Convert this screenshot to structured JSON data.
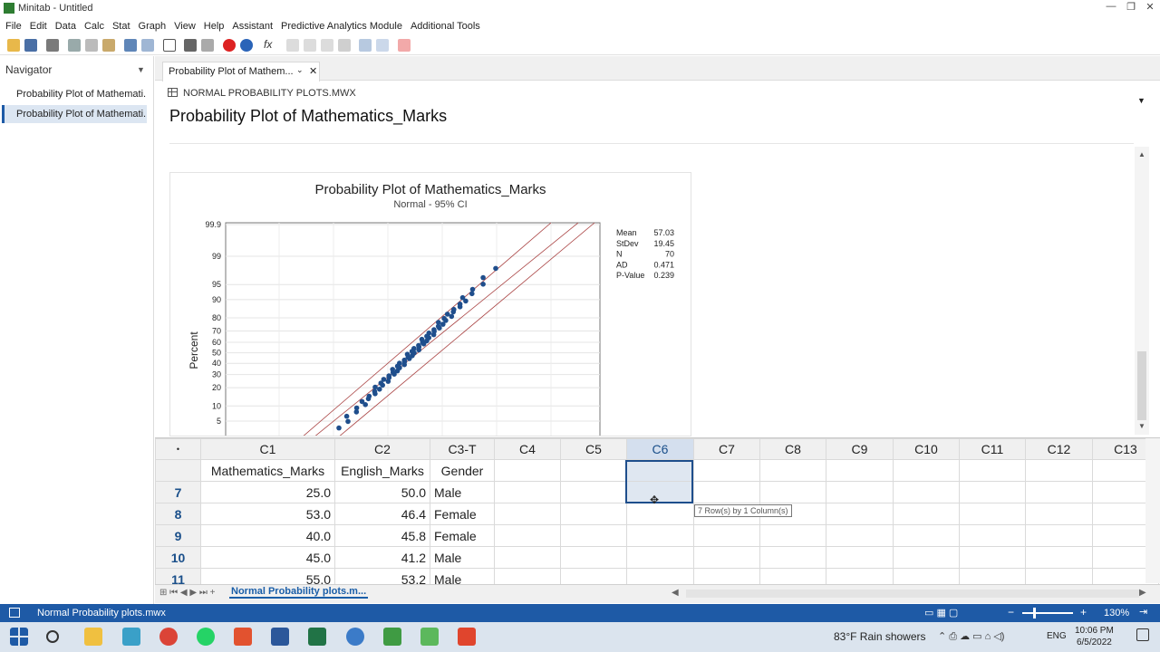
{
  "window": {
    "title": "Minitab - Untitled"
  },
  "menu": [
    "File",
    "Edit",
    "Data",
    "Calc",
    "Stat",
    "Graph",
    "View",
    "Help",
    "Assistant",
    "Predictive Analytics Module",
    "Additional Tools"
  ],
  "navigator": {
    "title": "Navigator",
    "items": [
      "Probability Plot of Mathemati...",
      "Probability Plot of Mathemati..."
    ]
  },
  "output": {
    "tab_label": "Probability Plot of Mathem...",
    "worksheet_ref": "NORMAL PROBABILITY PLOTS.MWX",
    "heading": "Probability Plot of Mathematics_Marks"
  },
  "chart_data": {
    "type": "scatter",
    "title": "Probability Plot of Mathematics_Marks",
    "subtitle": "Normal - 95% CI",
    "ylabel": "Percent",
    "yscale": "normal-probability",
    "yticks": [
      99.9,
      99,
      95,
      90,
      80,
      70,
      60,
      50,
      40,
      30,
      20,
      10,
      5
    ],
    "stats": [
      {
        "label": "Mean",
        "value": "57.03"
      },
      {
        "label": "StDev",
        "value": "19.45"
      },
      {
        "label": "N",
        "value": "70"
      },
      {
        "label": "AD",
        "value": "0.471"
      },
      {
        "label": "P-Value",
        "value": "0.239"
      }
    ],
    "points_percent": [
      3.5,
      4.9,
      6.3,
      7.7,
      9.2,
      10.6,
      12.0,
      13.4,
      14.8,
      16.2,
      17.6,
      19.0,
      20.4,
      21.8,
      23.2,
      24.6,
      26.1,
      27.5,
      28.9,
      30.3,
      31.7,
      33.1,
      34.5,
      35.9,
      37.3,
      38.7,
      40.1,
      41.5,
      43.0,
      44.4,
      45.8,
      47.2,
      48.6,
      50.0,
      51.4,
      52.8,
      54.2,
      55.6,
      57.0,
      58.5,
      59.9,
      61.3,
      62.7,
      64.1,
      65.5,
      66.9,
      68.3,
      69.7,
      71.1,
      72.5,
      73.9,
      75.4,
      76.8,
      78.2,
      79.6,
      81.0,
      82.4,
      83.8,
      85.2,
      86.6,
      88.0,
      89.4,
      90.8,
      92.3,
      93.7,
      95.1,
      96.5,
      97.9
    ]
  },
  "worksheet": {
    "corner": "•",
    "columns": [
      "C1",
      "C2",
      "C3-T",
      "C4",
      "C5",
      "C6",
      "C7",
      "C8",
      "C9",
      "C10",
      "C11",
      "C12",
      "C13"
    ],
    "names": [
      "Mathematics_Marks",
      "English_Marks",
      "Gender",
      "",
      "",
      "",
      "",
      "",
      "",
      "",
      "",
      "",
      ""
    ],
    "rows": [
      {
        "n": "7",
        "c1": "25.0",
        "c2": "50.0",
        "c3": "Male"
      },
      {
        "n": "8",
        "c1": "53.0",
        "c2": "46.4",
        "c3": "Female"
      },
      {
        "n": "9",
        "c1": "40.0",
        "c2": "45.8",
        "c3": "Female"
      },
      {
        "n": "10",
        "c1": "45.0",
        "c2": "41.2",
        "c3": "Male"
      },
      {
        "n": "11",
        "c1": "55.0",
        "c2": "53.2",
        "c3": "Male"
      }
    ],
    "tooltip": "7 Row(s) by 1 Column(s)",
    "sheet_tab": "Normal Probability plots.m..."
  },
  "status": {
    "text": "Normal Probability plots.mwx",
    "zoom": "130%"
  },
  "taskbar": {
    "weather": "83°F  Rain showers",
    "lang": "ENG",
    "time": "10:06 PM",
    "date": "6/5/2022"
  },
  "colors": {
    "accent": "#1e5aa6",
    "points": "#1f4e8c"
  }
}
